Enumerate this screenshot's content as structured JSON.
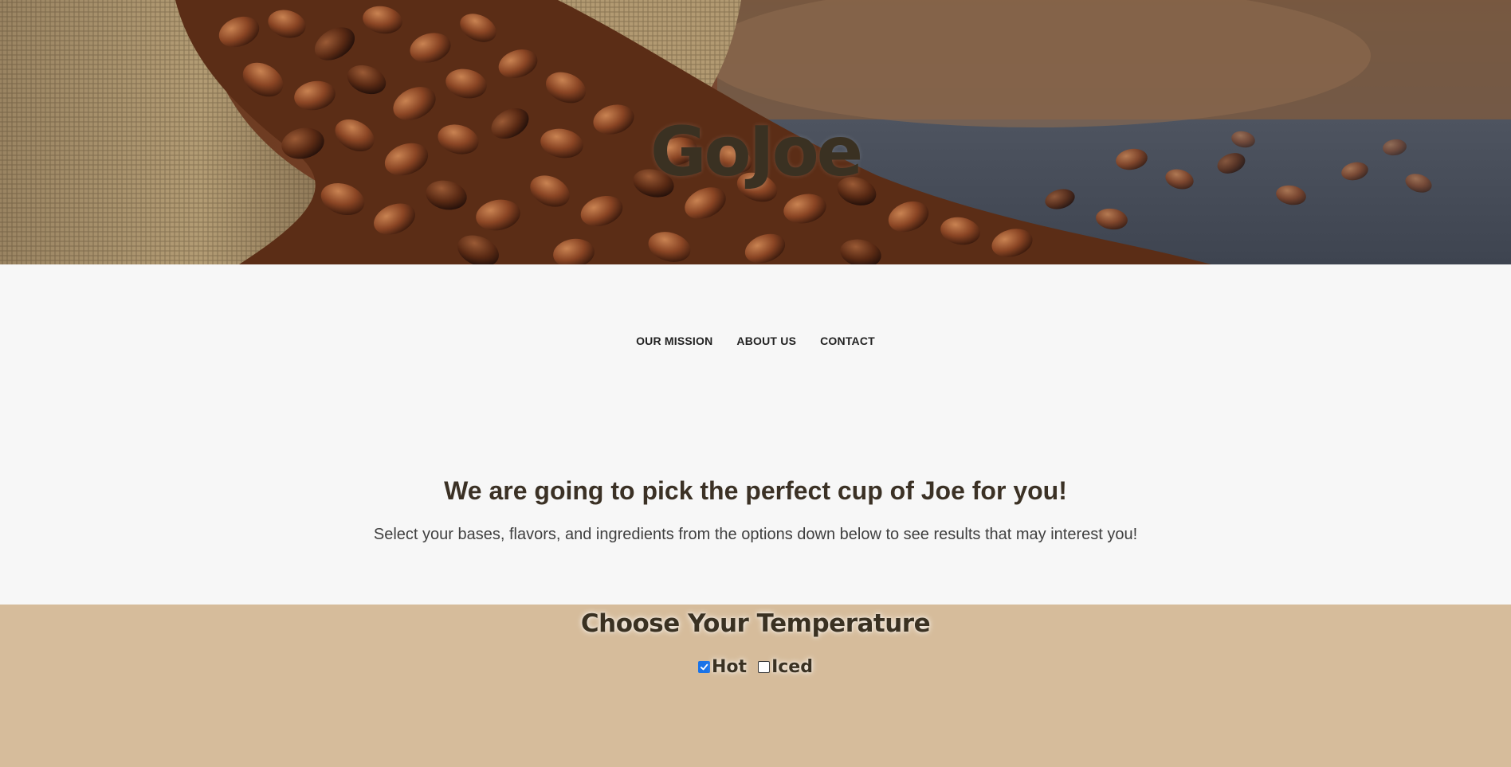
{
  "hero": {
    "title": "GoJoe",
    "image_subject": "coffee beans spilling from burlap sack"
  },
  "nav": {
    "items": [
      {
        "label": "OUR MISSION"
      },
      {
        "label": "ABOUT US"
      },
      {
        "label": "CONTACT"
      }
    ]
  },
  "intro": {
    "heading": "We are going to pick the perfect cup of Joe for you!",
    "text": "Select your bases, flavors, and ingredients from the options down below to see results that may interest you!"
  },
  "temperature": {
    "heading": "Choose Your Temperature",
    "options": [
      {
        "label": "Hot",
        "checked": true
      },
      {
        "label": "Iced",
        "checked": false
      }
    ]
  },
  "colors": {
    "page_bg": "#f7f7f7",
    "section_bg": "#d6bc9b",
    "title_text": "#3a3122",
    "checkbox_accent": "#1a73e8"
  },
  "icons": {
    "checkbox_checked": "check-icon"
  }
}
